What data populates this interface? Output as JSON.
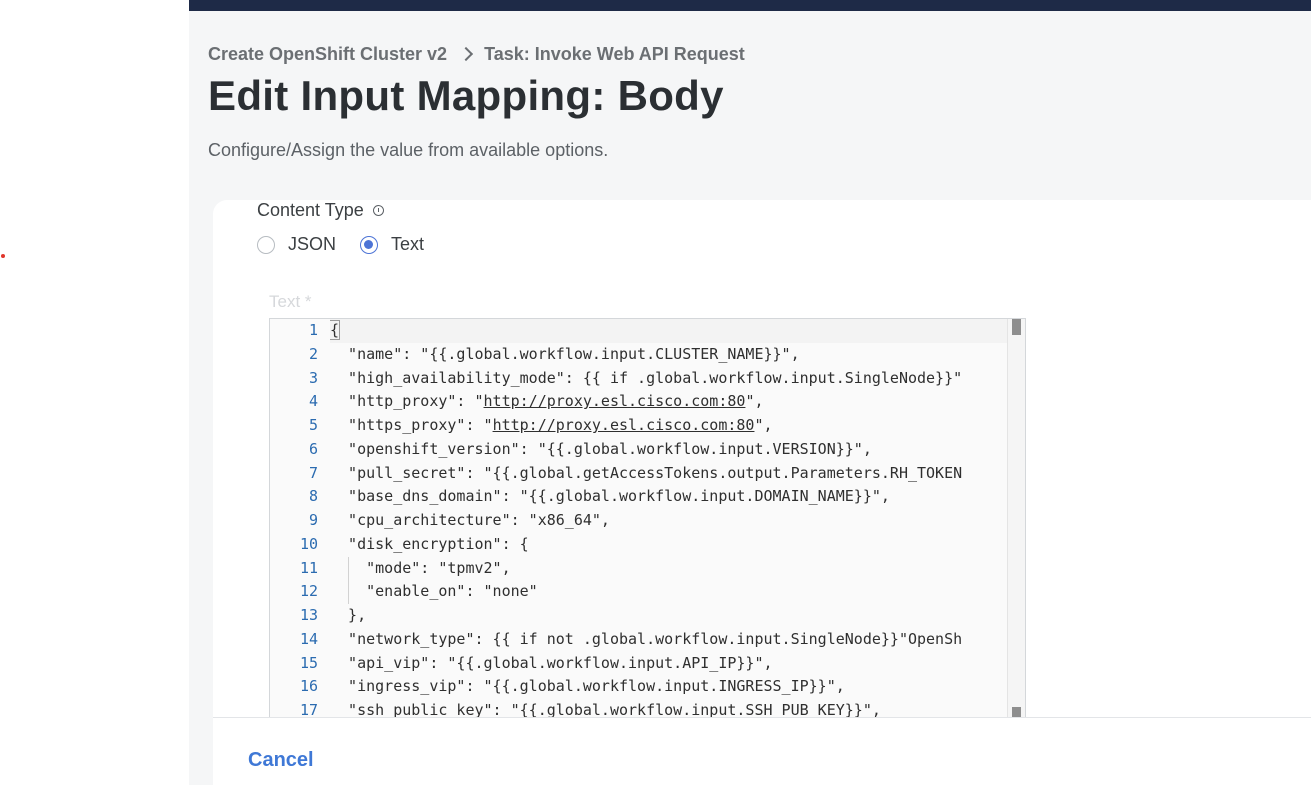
{
  "breadcrumb": {
    "items": [
      "Create OpenShift Cluster v2",
      "Task: Invoke Web API Request"
    ]
  },
  "page": {
    "title": "Edit Input Mapping: Body",
    "subtitle": "Configure/Assign the value from available options."
  },
  "content_type": {
    "label": "Content Type",
    "options": [
      {
        "label": "JSON",
        "selected": false
      },
      {
        "label": "Text",
        "selected": true
      }
    ]
  },
  "editor": {
    "label": "Text *",
    "lines": [
      {
        "num": "1",
        "text": "{"
      },
      {
        "num": "2",
        "text": "  \"name\": \"{{.global.workflow.input.CLUSTER_NAME}}\","
      },
      {
        "num": "3",
        "text": "  \"high_availability_mode\": {{ if .global.workflow.input.SingleNode}}\""
      },
      {
        "num": "4",
        "text": "  \"http_proxy\": \"http://proxy.esl.cisco.com:80\","
      },
      {
        "num": "5",
        "text": "  \"https_proxy\": \"http://proxy.esl.cisco.com:80\","
      },
      {
        "num": "6",
        "text": "  \"openshift_version\": \"{{.global.workflow.input.VERSION}}\","
      },
      {
        "num": "7",
        "text": "  \"pull_secret\": \"{{.global.getAccessTokens.output.Parameters.RH_TOKEN"
      },
      {
        "num": "8",
        "text": "  \"base_dns_domain\": \"{{.global.workflow.input.DOMAIN_NAME}}\","
      },
      {
        "num": "9",
        "text": "  \"cpu_architecture\": \"x86_64\","
      },
      {
        "num": "10",
        "text": "  \"disk_encryption\": {"
      },
      {
        "num": "11",
        "text": "    \"mode\": \"tpmv2\","
      },
      {
        "num": "12",
        "text": "    \"enable_on\": \"none\""
      },
      {
        "num": "13",
        "text": "  },"
      },
      {
        "num": "14",
        "text": "  \"network_type\": {{ if not .global.workflow.input.SingleNode}}\"OpenSh"
      },
      {
        "num": "15",
        "text": "  \"api_vip\": \"{{.global.workflow.input.API_IP}}\","
      },
      {
        "num": "16",
        "text": "  \"ingress_vip\": \"{{.global.workflow.input.INGRESS_IP}}\","
      },
      {
        "num": "17",
        "text": "  \"ssh_public_key\": \"{{.global.workflow.input.SSH_PUB_KEY}}\","
      }
    ]
  },
  "footer": {
    "cancel_label": "Cancel"
  },
  "colors": {
    "accent": "#3f78d6",
    "topbar": "#1e2a47",
    "line_number": "#2b6bb0"
  }
}
